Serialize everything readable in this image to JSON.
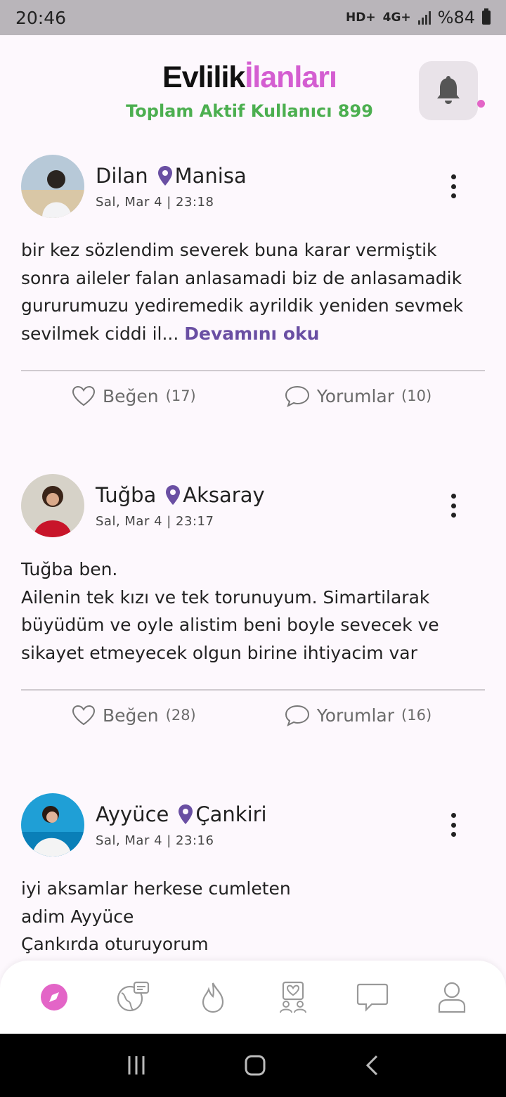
{
  "status_bar": {
    "time": "20:46",
    "network_hd": "HD+",
    "network_4g": "4G+",
    "battery": "%84"
  },
  "header": {
    "logo_part1": "Evlilik",
    "logo_part2": "İlanları",
    "active_users": "Toplam Aktif Kullanıcı 899",
    "notification_icon": "bell-icon",
    "accent_color": "#d45ed1"
  },
  "posts": [
    {
      "name": "Dilan",
      "city": "Manisa",
      "date": "Sal, Mar 4 | 23:18",
      "text": "bir kez sözlendim severek buna karar vermiştik sonra aileler falan anlasamadi biz de anlasamadik gururumuzu yediremedik ayrildik yeniden sevmek sevilmek ciddi il... ",
      "read_more": "Devamını oku",
      "like_label": "Beğen",
      "like_count": "(17)",
      "comment_label": "Yorumlar",
      "comment_count": "(10)"
    },
    {
      "name": "Tuğba",
      "city": "Aksaray",
      "date": "Sal, Mar 4 | 23:17",
      "text": "Tuğba ben.\n Ailenin tek kızı ve tek torunuyum. Simartilarak büyüdüm ve oyle alistim beni boyle sevecek ve sikayet etmeyecek olgun birine ihtiyacim var",
      "like_label": "Beğen",
      "like_count": "(28)",
      "comment_label": "Yorumlar",
      "comment_count": "(16)"
    },
    {
      "name": "Ayyüce",
      "city": "Çankiri",
      "date": "Sal, Mar 4 | 23:16",
      "text": "iyi aksamlar herkese cumleten\nadim Ayyüce\nÇankırda oturuyorum"
    }
  ],
  "bottom_nav": {
    "items": [
      "compass-icon",
      "globe-chat-icon",
      "flame-icon",
      "matches-icon",
      "messages-icon",
      "profile-icon"
    ],
    "active_color": "#e365c7"
  }
}
